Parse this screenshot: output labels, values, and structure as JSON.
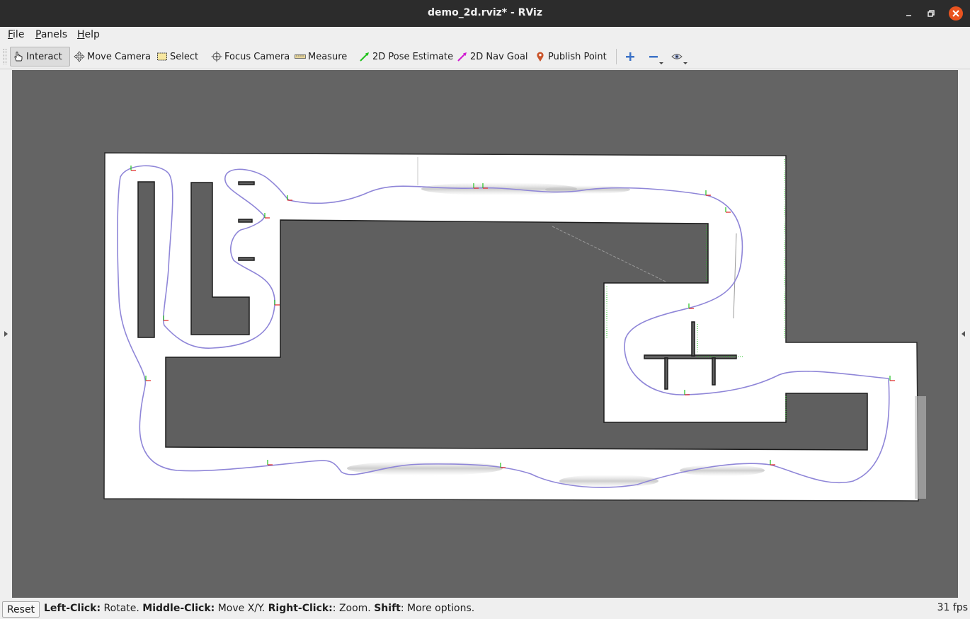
{
  "window": {
    "title": "demo_2d.rviz* - RViz"
  },
  "menu": {
    "file": "File",
    "panels": "Panels",
    "help": "Help"
  },
  "toolbar": {
    "interact": "Interact",
    "move_camera": "Move Camera",
    "select": "Select",
    "focus_camera": "Focus Camera",
    "measure": "Measure",
    "pose_estimate": "2D Pose Estimate",
    "nav_goal": "2D Nav Goal",
    "publish_point": "Publish Point"
  },
  "colors": {
    "viewport_background": "#646464",
    "map_free": "#ffffff",
    "map_occupied": "#5f5f5f",
    "trajectory": "#8f86d8",
    "pose_estimate_icon": "#22c21e",
    "nav_goal_icon": "#d11ad1",
    "publish_point_icon": "#c9542a",
    "close_button": "#e95420"
  },
  "icons": {
    "interact": "hand-pointer-icon",
    "move_camera": "move-arrows-icon",
    "select": "selection-rectangle-icon",
    "focus_camera": "crosshair-icon",
    "measure": "ruler-icon",
    "pose_estimate": "green-arrow-icon",
    "nav_goal": "magenta-arrow-icon",
    "publish_point": "map-pin-icon",
    "add_tool": "plus-icon",
    "remove_tool": "minus-icon",
    "view": "eye-icon"
  },
  "status": {
    "reset": "Reset",
    "left_click": "Left-Click:",
    "left_click_desc": " Rotate. ",
    "middle_click": "Middle-Click:",
    "middle_click_desc": " Move X/Y. ",
    "right_click": "Right-Click:",
    "right_click_desc": ": Zoom. ",
    "shift": "Shift",
    "shift_desc": ": More options.",
    "fps": "31 fps"
  }
}
